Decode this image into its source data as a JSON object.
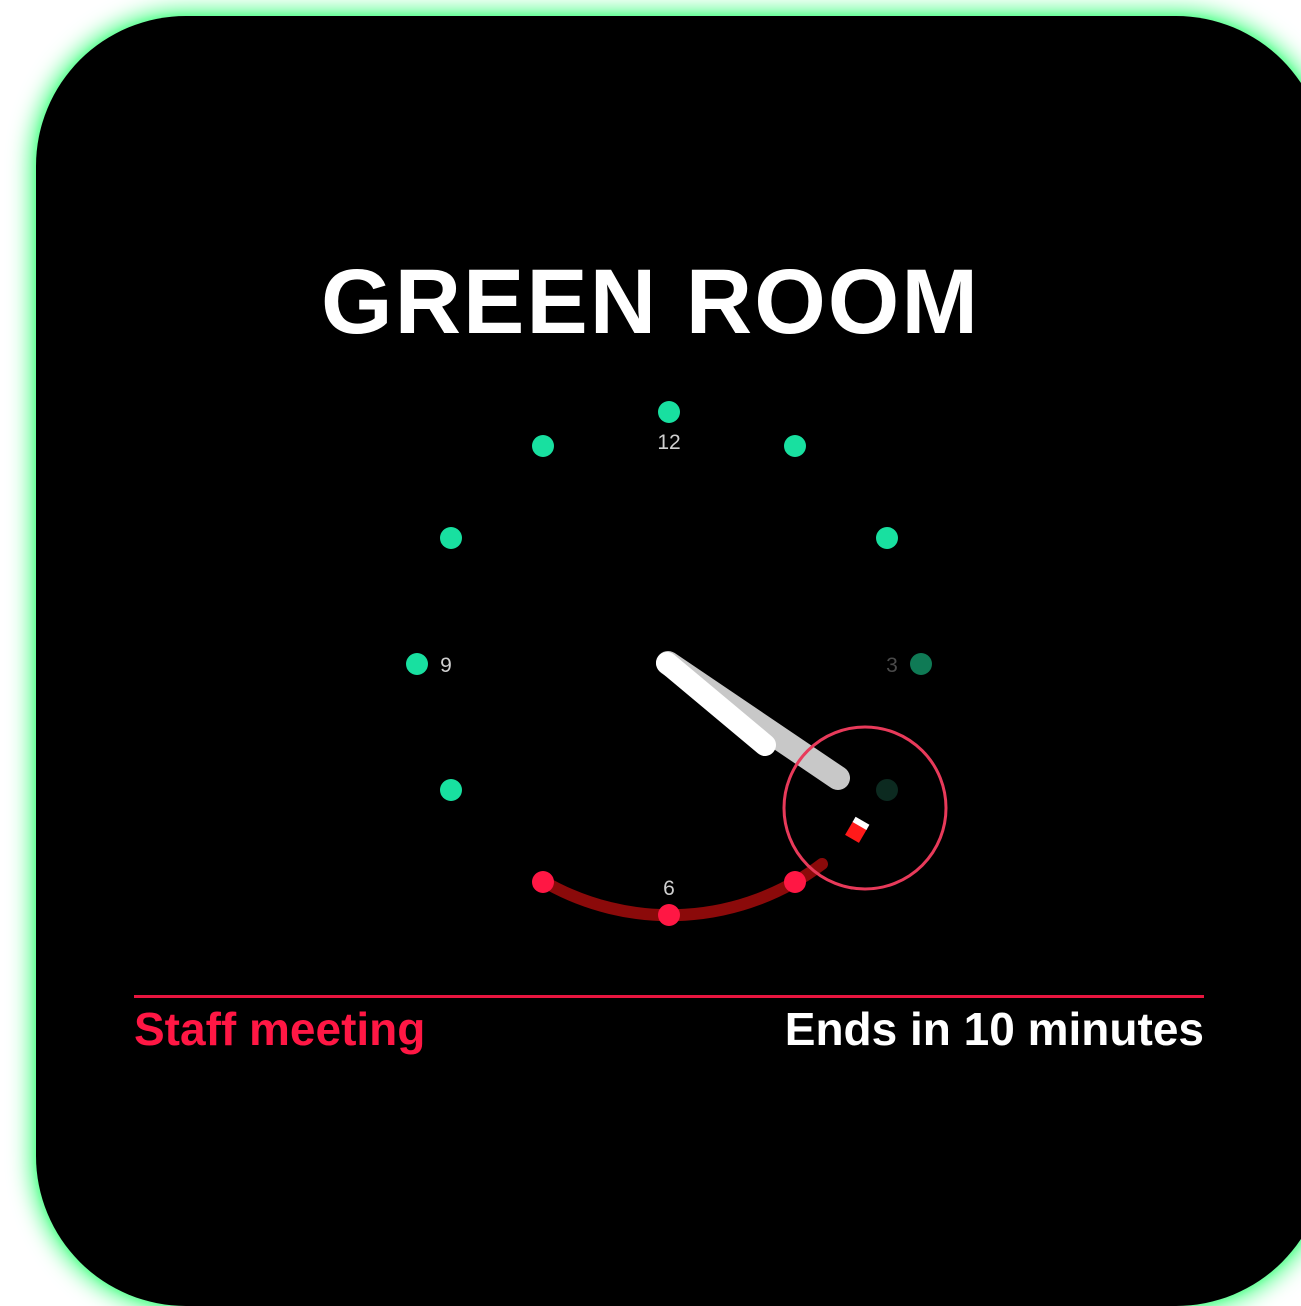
{
  "room": {
    "name": "GREEN ROOM"
  },
  "clock": {
    "numerals": {
      "twelve": "12",
      "three": "3",
      "six": "6",
      "nine": "9"
    },
    "colors": {
      "free_dot": "#18e0a0",
      "dim_dot": "#0f7a55",
      "faint_dot": "#0c2a20",
      "busy_dot": "#ff1744",
      "busy_arc": "#8b0a0a",
      "hour_hand": "#ffffff",
      "minute_hand": "#c8c8c8",
      "highlight_ring": "#e83a5a"
    },
    "time_shown": "4:20"
  },
  "meeting": {
    "title": "Staff meeting",
    "status": "Ends in 10 minutes",
    "accent_color": "#ff1744"
  }
}
